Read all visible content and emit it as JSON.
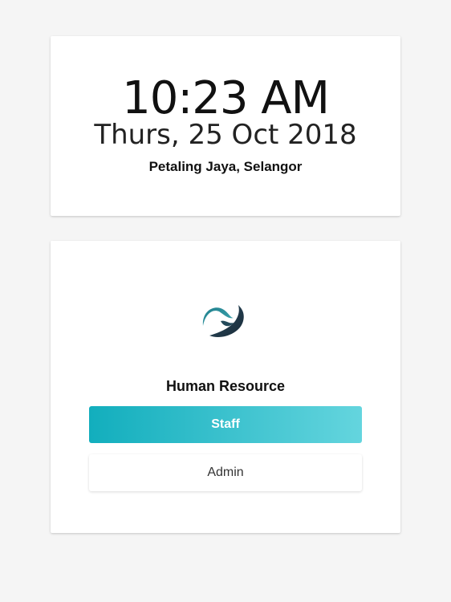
{
  "clock": {
    "time": "10:23 AM",
    "date": "Thurs, 25 Oct 2018",
    "location": "Petaling Jaya, Selangor"
  },
  "login": {
    "logo_icon": "wave-swirl-logo-icon",
    "heading": "Human Resource",
    "staff_label": "Staff",
    "admin_label": "Admin"
  },
  "colors": {
    "accent": "#12aebd",
    "accent_light": "#64d5de",
    "logo_dark": "#1d3344",
    "logo_teal": "#2f8f9a"
  }
}
